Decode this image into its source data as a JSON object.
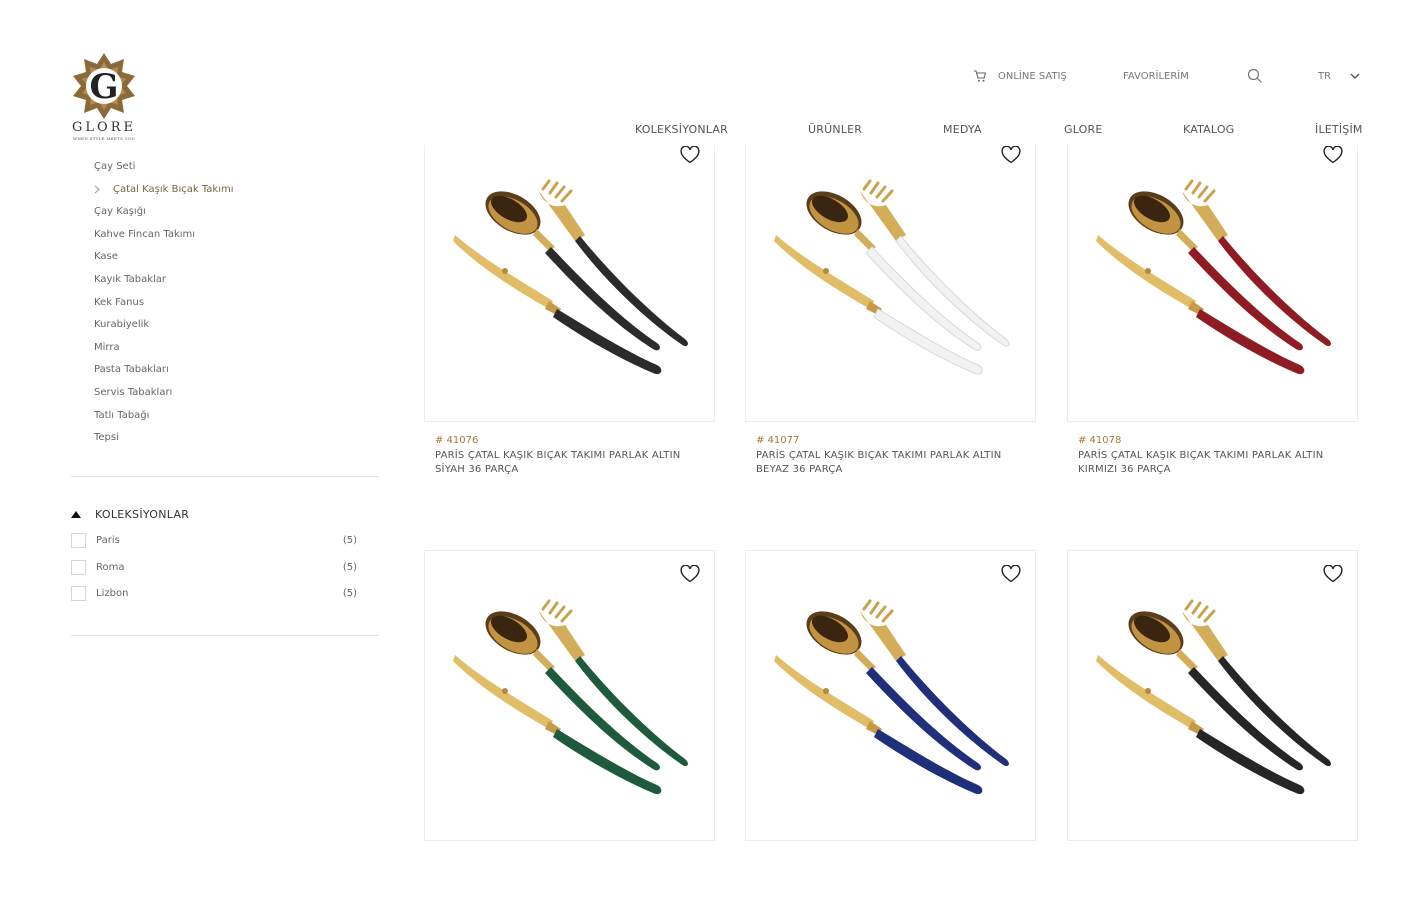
{
  "brand": {
    "name": "GLORE",
    "tagline": "WHEN STYLE MEETS YOU",
    "gold": "#8a6a3a"
  },
  "topbar": {
    "online_sale": "ONLİNE SATIŞ",
    "favorites": "FAVORİLERİM",
    "language": "TR"
  },
  "nav": {
    "collections": "KOLEKSİYONLAR",
    "products": "ÜRÜNLER",
    "media": "MEDYA",
    "glore": "GLORE",
    "catalog": "KATALOG",
    "contact": "İLETİŞİM"
  },
  "categories": [
    "Çay Seti",
    "Çatal Kaşık Bıçak Takımı",
    "Çay Kaşığı",
    "Kahve Fincan Takımı",
    "Kase",
    "Kayık Tabaklar",
    "Kek Fanus",
    "Kurabiyelik",
    "Mirra",
    "Pasta Tabakları",
    "Servis Tabakları",
    "Tatlı Tabağı",
    "Tepsi"
  ],
  "active_category": "Çatal Kaşık Bıçak Takımı",
  "filters": {
    "heading": "KOLEKSİYONLAR",
    "options": [
      {
        "name": "Paris",
        "count": "(5)",
        "checked": false
      },
      {
        "name": "Roma",
        "count": "(5)",
        "checked": false
      },
      {
        "name": "Lizbon",
        "count": "(5)",
        "checked": false
      }
    ]
  },
  "products": [
    {
      "code": "# 41076",
      "title": "PARİS ÇATAL KAŞIK BIÇAK TAKIMI PARLAK ALTIN SİYAH 36 PARÇA",
      "handle_color": "#2b2b2b"
    },
    {
      "code": "# 41077",
      "title": "PARİS ÇATAL KAŞIK BIÇAK TAKIMI PARLAK ALTIN BEYAZ 36 PARÇA",
      "handle_color": "#f2f2f2"
    },
    {
      "code": "# 41078",
      "title": "PARİS ÇATAL KAŞIK BIÇAK TAKIMI PARLAK ALTIN KIRMIZI 36 PARÇA",
      "handle_color": "#8e1c24"
    },
    {
      "code": "",
      "title": "",
      "handle_color": "#1f5a3e"
    },
    {
      "code": "",
      "title": "",
      "handle_color": "#1f2f7a"
    },
    {
      "code": "",
      "title": "",
      "handle_color": "#262626"
    }
  ]
}
